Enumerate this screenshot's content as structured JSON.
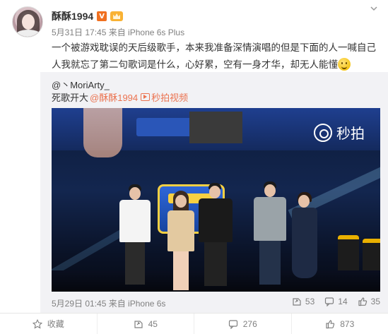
{
  "post": {
    "username": "酥酥1994",
    "vip_badge": "V",
    "meta": "5月31日 17:45 来自 iPhone 6s Plus",
    "text": "一个被游戏耽误的天后级歌手，本来我准备深情演唱的但是下面的人一喊自己人我就忘了第二句歌词是什么，心好累，空有一身才华，却无人能懂"
  },
  "repost": {
    "user": "@丶MoriArty_",
    "text_prefix": "死歌开大",
    "mention": "@酥酥1994",
    "link_text": "秒拍视频",
    "video_watermark": "秒拍",
    "time_source": "5月29日 01:45 来自 iPhone 6s",
    "stats": {
      "reposts": "53",
      "comments": "14",
      "likes": "35"
    }
  },
  "actions": {
    "favorite": "收藏",
    "repost": "45",
    "comment": "276",
    "like": "873"
  },
  "colors": {
    "accent": "#eb7350",
    "meta_gray": "#808080",
    "repost_bg": "#f2f2f5"
  }
}
